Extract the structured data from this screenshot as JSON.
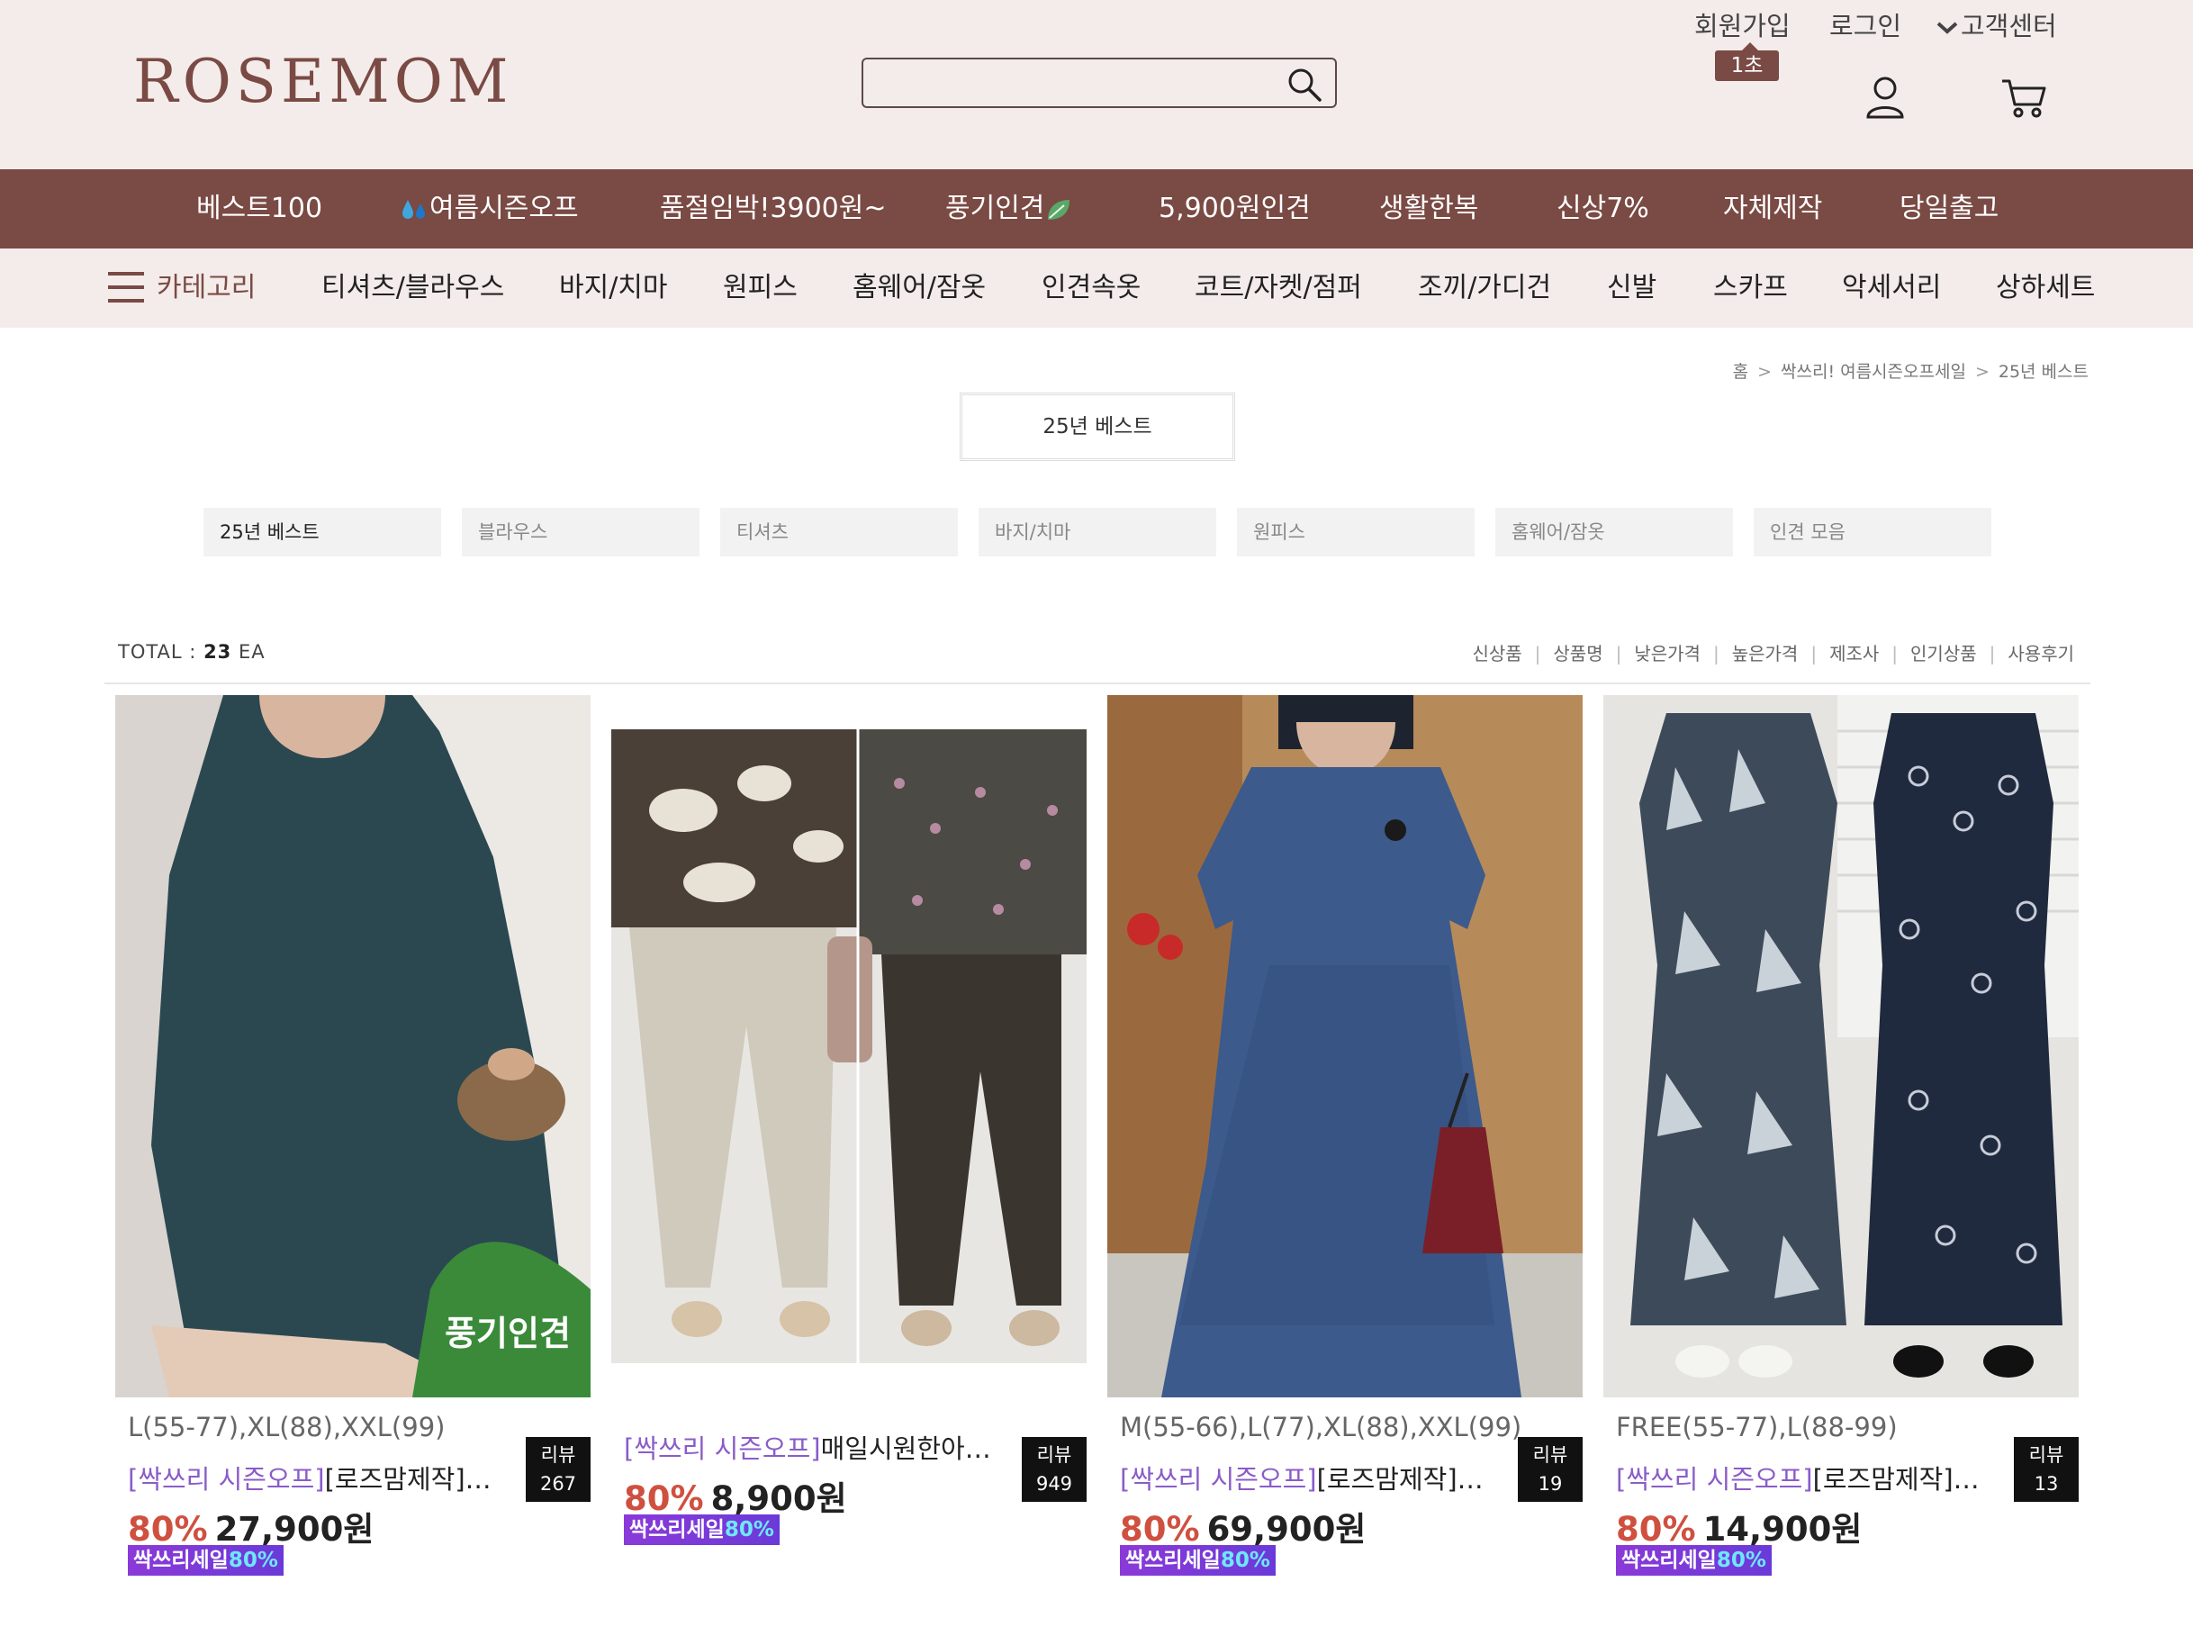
{
  "brand": {
    "logo_text": "ROSEMOM"
  },
  "search": {
    "placeholder": "",
    "value": ""
  },
  "top_links": {
    "join": "회원가입",
    "login": "로그인",
    "support": "고객센터",
    "join_badge": "1초"
  },
  "main_nav": [
    "베스트100",
    "여름시즌오프",
    "품절임박!3900원~",
    "풍기인견",
    "5,900원인견",
    "생활한복",
    "신상7%",
    "자체제작",
    "당일출고"
  ],
  "category_nav": {
    "label": "카테고리",
    "items": [
      "티셔츠/블라우스",
      "바지/치마",
      "원피스",
      "홈웨어/잠옷",
      "인견속옷",
      "코트/자켓/점퍼",
      "조끼/가디건",
      "신발",
      "스카프",
      "악세서리",
      "상하세트"
    ]
  },
  "breadcrumb": [
    "홈",
    "싹쓰리! 여름시즌오프세일",
    "25년 베스트"
  ],
  "page_title": "25년 베스트",
  "subcategories": [
    "25년 베스트",
    "블라우스",
    "티셔츠",
    "바지/치마",
    "원피스",
    "홈웨어/잠옷",
    "인견 모음"
  ],
  "listing": {
    "total_label": "TOTAL :",
    "total_count": "23",
    "total_unit": "EA",
    "sorts": [
      "신상품",
      "상품명",
      "낮은가격",
      "높은가격",
      "제조사",
      "인기상품",
      "사용후기"
    ]
  },
  "products": [
    {
      "sizes": "L(55-77),XL(88),XXL(99)",
      "tag": "[싹쓰리 시즌오프]",
      "name": "[로즈맘제작]진화…",
      "discount": "80%",
      "price": "27,900원",
      "review_label": "리뷰",
      "review_count": "267",
      "sale_badge_text": "싹쓰리세일",
      "sale_badge_pct": "80%",
      "image_label": "풍기인견"
    },
    {
      "sizes": "",
      "tag": "[싹쓰리 시즌오프]",
      "name": "매일시원한아이…",
      "discount": "80%",
      "price": "8,900원",
      "review_label": "리뷰",
      "review_count": "949",
      "sale_badge_text": "싹쓰리세일",
      "sale_badge_pct": "80%"
    },
    {
      "sizes": "M(55-66),L(77),XL(88),XXL(99)",
      "tag": "[싹쓰리 시즌오프]",
      "name": "[로즈맘제작]연우…",
      "discount": "80%",
      "price": "69,900원",
      "review_label": "리뷰",
      "review_count": "19",
      "sale_badge_text": "싹쓰리세일",
      "sale_badge_pct": "80%"
    },
    {
      "sizes": "FREE(55-77),L(88-99)",
      "tag": "[싹쓰리 시즌오프]",
      "name": "[로즈맘제작]다롬…",
      "discount": "80%",
      "price": "14,900원",
      "review_label": "리뷰",
      "review_count": "13",
      "sale_badge_text": "싹쓰리세일",
      "sale_badge_pct": "80%"
    }
  ],
  "colors": {
    "brand": "#7a4a44",
    "header_bg": "#f4ecea",
    "discount": "#d05040",
    "tag": "#8a5cc9"
  }
}
